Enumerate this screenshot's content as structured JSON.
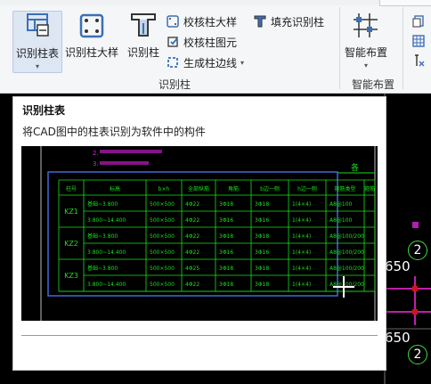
{
  "ribbon": {
    "buttons": {
      "identify_table": "识别柱表",
      "identify_detail": "识别柱大样",
      "identify_column": "识别柱",
      "smart_layout": "智能布置"
    },
    "small_buttons": {
      "check_detail": "校核柱大样",
      "fill_identify": "填充识别柱",
      "check_element": "校核柱图元",
      "gen_edge": "生成柱边线"
    },
    "groups": {
      "identify_column": "识别柱",
      "smart_layout": "智能布置"
    }
  },
  "tooltip": {
    "title": "识别柱表",
    "description": "将CAD图中的柱表识别为软件中的构件",
    "preview": {
      "notes": [
        "2.",
        "3."
      ],
      "header_right": "各",
      "columns": [
        "柱号",
        "标高",
        "b×h",
        "全部纵筋",
        "角筋",
        "b边一侧",
        "h边一侧",
        "箍筋类型",
        "箍筋"
      ],
      "rows": [
        {
          "id": "KZ1",
          "cells": [
            [
              "基础~3.800",
              "500×500",
              "4Φ22",
              "3Φ18",
              "3Φ18",
              "1(4×4)",
              "A8@100"
            ],
            [
              "3.800~14.400",
              "500×500",
              "4Φ22",
              "3Φ16",
              "3Φ16",
              "1(4×4)",
              "A8@100"
            ]
          ]
        },
        {
          "id": "KZ2",
          "cells": [
            [
              "基础~3.800",
              "500×500",
              "4Φ22",
              "3Φ18",
              "3Φ18",
              "1(4×4)",
              "A8@100/200"
            ],
            [
              "3.800~14.400",
              "500×500",
              "4Φ22",
              "3Φ16",
              "3Φ16",
              "1(4×4)",
              "A8@100/200"
            ]
          ]
        },
        {
          "id": "KZ3",
          "cells": [
            [
              "基础~3.800",
              "500×500",
              "4Φ25",
              "3Φ18",
              "3Φ18",
              "1(4×4)",
              "A8@100/200"
            ],
            [
              "3.800~14.400",
              "500×500",
              "4Φ22",
              "3Φ18",
              "3Φ18",
              "1(4×4)",
              "A8@100/200"
            ]
          ]
        }
      ]
    }
  },
  "cad": {
    "dim1": "650",
    "dim2": "650",
    "axis1": "2",
    "axis2": "2"
  },
  "colors": {
    "green": "#19e019",
    "blue": "#3f6bd8",
    "magenta": "#e020e0"
  }
}
